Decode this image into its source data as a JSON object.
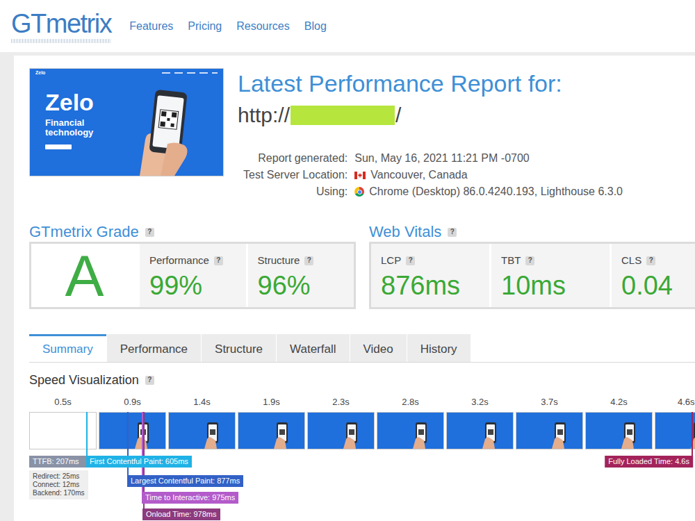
{
  "header": {
    "logo": "GTmetrix",
    "nav": [
      "Features",
      "Pricing",
      "Resources",
      "Blog"
    ]
  },
  "thumbnail": {
    "brand": "Zelo",
    "headline": "Zelo",
    "tagline": "Financial technology"
  },
  "report": {
    "title": "Latest Performance Report for:",
    "url": {
      "prefix": "http://",
      "redacted": true,
      "suffix": "/"
    },
    "details": [
      {
        "label": "Report generated:",
        "value": "Sun, May 16, 2021 11:21 PM -0700",
        "kind": "text"
      },
      {
        "label": "Test Server Location:",
        "value": "Vancouver, Canada",
        "kind": "flag"
      },
      {
        "label": "Using:",
        "value": "Chrome (Desktop) 86.0.4240.193, Lighthouse 6.3.0",
        "kind": "browser"
      }
    ]
  },
  "grade": {
    "title": "GTmetrix Grade",
    "help": "?",
    "letter": "A",
    "metrics": [
      {
        "label": "Performance",
        "help": "?",
        "value": "99%"
      },
      {
        "label": "Structure",
        "help": "?",
        "value": "96%"
      }
    ]
  },
  "web_vitals": {
    "title": "Web Vitals",
    "help": "?",
    "metrics": [
      {
        "label": "LCP",
        "help": "?",
        "value": "876ms"
      },
      {
        "label": "TBT",
        "help": "?",
        "value": "10ms"
      },
      {
        "label": "CLS",
        "help": "?",
        "value": "0.04"
      }
    ]
  },
  "tabs": [
    {
      "label": "Summary",
      "selected": true
    },
    {
      "label": "Performance",
      "selected": false
    },
    {
      "label": "Structure",
      "selected": false
    },
    {
      "label": "Waterfall",
      "selected": false
    },
    {
      "label": "Video",
      "selected": false
    },
    {
      "label": "History",
      "selected": false
    }
  ],
  "speed_visualization": {
    "title": "Speed Visualization",
    "help": "?",
    "frames": [
      {
        "time": "0.5s",
        "blank": true
      },
      {
        "time": "0.9s",
        "blank": false
      },
      {
        "time": "1.4s",
        "blank": false
      },
      {
        "time": "1.9s",
        "blank": false
      },
      {
        "time": "2.3s",
        "blank": false
      },
      {
        "time": "2.8s",
        "blank": false
      },
      {
        "time": "3.2s",
        "blank": false
      },
      {
        "time": "3.7s",
        "blank": false
      },
      {
        "time": "4.2s",
        "blank": false
      },
      {
        "time": "4.6s",
        "blank": false
      }
    ],
    "markers": [
      {
        "label": "TTFB: 207ms",
        "color": "#8a92a6",
        "details": [
          "Redirect: 25ms",
          "Connect: 12ms",
          "Backend: 170ms"
        ]
      },
      {
        "label": "First Contentful Paint: 605ms",
        "color": "#1fb2e6",
        "details": []
      },
      {
        "label": "Largest Contentful Paint: 877ms",
        "color": "#3261c6",
        "details": []
      },
      {
        "label": "Time to Interactive: 975ms",
        "color": "#b35bca",
        "details": []
      },
      {
        "label": "Onload Time: 978ms",
        "color": "#8d3a7e",
        "details": []
      },
      {
        "label": "Fully Loaded Time: 4.6s",
        "color": "#a3235a",
        "details": []
      }
    ]
  }
}
